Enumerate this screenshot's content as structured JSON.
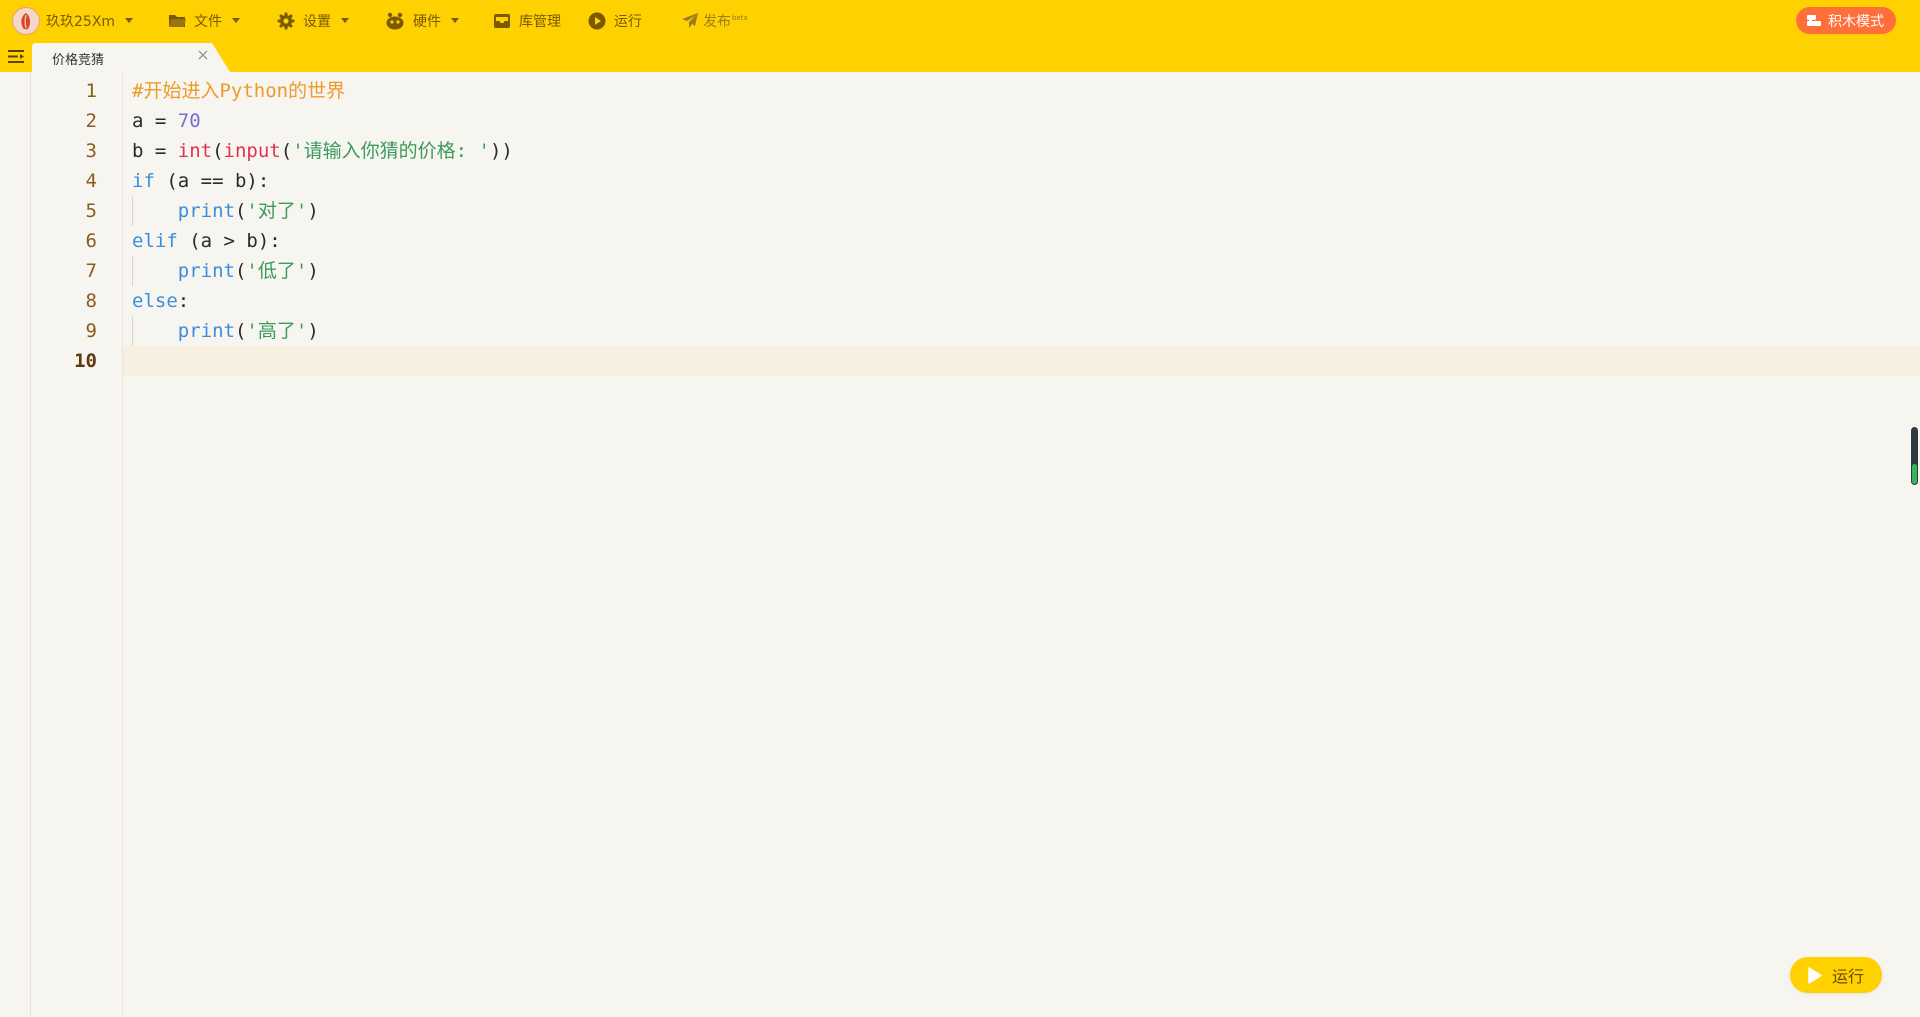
{
  "menu": {
    "user_name": "玖玖25Xm",
    "file": "文件",
    "settings": "设置",
    "hardware": "硬件",
    "library": "库管理",
    "run": "运行",
    "publish": "发布",
    "publish_badge": "beta",
    "block_mode": "积木模式"
  },
  "tabs": [
    {
      "label": "价格竞猜",
      "active": true
    }
  ],
  "editor": {
    "active_line": 10,
    "line_numbers": [
      "1",
      "2",
      "3",
      "4",
      "5",
      "6",
      "7",
      "8",
      "9",
      "10"
    ],
    "lines": [
      [
        {
          "t": "comment",
          "v": "#开始进入Python的世界"
        }
      ],
      [
        {
          "t": "plain",
          "v": "a = "
        },
        {
          "t": "num",
          "v": "70"
        }
      ],
      [
        {
          "t": "plain",
          "v": "b = "
        },
        {
          "t": "builtin",
          "v": "int"
        },
        {
          "t": "plain",
          "v": "("
        },
        {
          "t": "builtin",
          "v": "input"
        },
        {
          "t": "plain",
          "v": "("
        },
        {
          "t": "str",
          "v": "'请输入你猜的价格: '"
        },
        {
          "t": "plain",
          "v": "))"
        }
      ],
      [
        {
          "t": "kw",
          "v": "if"
        },
        {
          "t": "plain",
          "v": " (a == b):"
        }
      ],
      [
        {
          "t": "plain",
          "v": "    "
        },
        {
          "t": "kw",
          "v": "print"
        },
        {
          "t": "plain",
          "v": "("
        },
        {
          "t": "str",
          "v": "'对了'"
        },
        {
          "t": "plain",
          "v": ")"
        }
      ],
      [
        {
          "t": "kw",
          "v": "elif"
        },
        {
          "t": "plain",
          "v": " (a > b):"
        }
      ],
      [
        {
          "t": "plain",
          "v": "    "
        },
        {
          "t": "kw",
          "v": "print"
        },
        {
          "t": "plain",
          "v": "("
        },
        {
          "t": "str",
          "v": "'低了'"
        },
        {
          "t": "plain",
          "v": ")"
        }
      ],
      [
        {
          "t": "kw",
          "v": "else"
        },
        {
          "t": "plain",
          "v": ":"
        }
      ],
      [
        {
          "t": "plain",
          "v": "    "
        },
        {
          "t": "kw",
          "v": "print"
        },
        {
          "t": "plain",
          "v": "("
        },
        {
          "t": "str",
          "v": "'高了'"
        },
        {
          "t": "plain",
          "v": ")"
        }
      ],
      []
    ],
    "indent_guide_lines": [
      5,
      7,
      9
    ]
  },
  "scroll_position": 0.35,
  "run_button": {
    "label": "运行"
  },
  "colors": {
    "toolbar": "#ffd100",
    "accent_orange": "#ff6f3a",
    "comment": "#ee9a2b",
    "number": "#7b6bd6",
    "builtin": "#e0334f",
    "keyword": "#3c8fd8",
    "string": "#3d9a5c"
  }
}
